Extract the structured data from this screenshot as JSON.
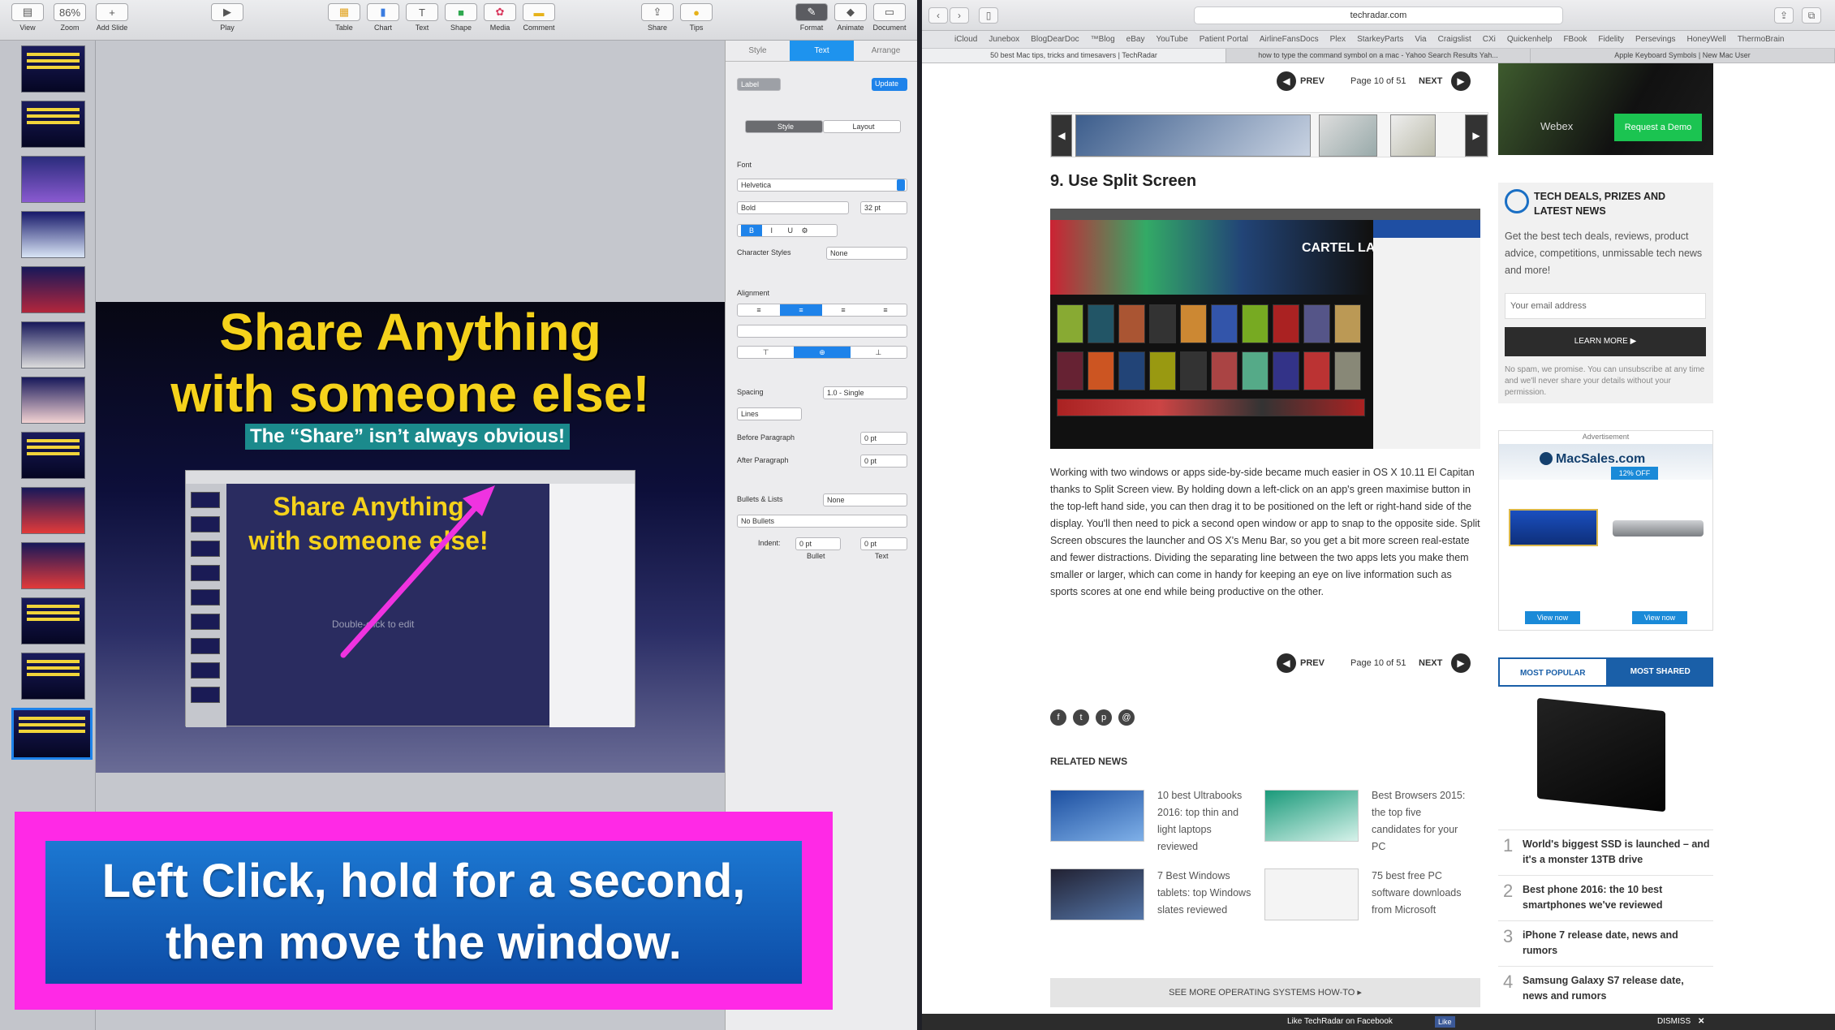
{
  "keynote": {
    "toolbar": {
      "view": "View",
      "zoom": "Zoom",
      "zoom_value": "86%",
      "add_slide": "Add Slide",
      "play": "Play",
      "table": "Table",
      "chart": "Chart",
      "text": "Text",
      "shape": "Shape",
      "media": "Media",
      "comment": "Comment",
      "share": "Share",
      "tips": "Tips",
      "format": "Format",
      "animate": "Animate",
      "document": "Document"
    },
    "slide": {
      "title_line1": "Share Anything",
      "title_line2": "with someone else!",
      "subtitle": "The “Share” isn’t always obvious!",
      "embedded_line1": "Share Anything",
      "embedded_line2": "with someone else!",
      "embedded_placeholder": "Double-click to edit"
    },
    "inspector": {
      "tabs": [
        "Style",
        "Text",
        "Arrange"
      ],
      "paragraph_style": "Label",
      "update": "Update",
      "style_tab": "Style",
      "layout_tab": "Layout",
      "font_label": "Font",
      "font": "Helvetica",
      "weight": "Bold",
      "size": "32 pt",
      "character_styles_label": "Character Styles",
      "character_styles": "None",
      "alignment_label": "Alignment",
      "spacing_label": "Spacing",
      "spacing": "1.0 - Single",
      "lines": "Lines",
      "before_paragraph": "Before Paragraph",
      "before_value": "0 pt",
      "after_paragraph": "After Paragraph",
      "after_value": "0 pt",
      "bullets_label": "Bullets & Lists",
      "bullets": "None",
      "no_bullets": "No Bullets",
      "indent_label": "Indent:",
      "indent_bullet": "0 pt",
      "indent_text": "0 pt",
      "bullet_caption": "Bullet",
      "text_caption": "Text"
    }
  },
  "callout": {
    "line1": "Left Click, hold for a second,",
    "line2": "then move the window."
  },
  "safari": {
    "url": "techradar.com",
    "bookmarks": [
      "iCloud",
      "Junebox",
      "BlogDearDoc",
      "™Blog",
      "eBay",
      "YouTube",
      "Patient Portal",
      "AirlineFansDocs",
      "Plex",
      "StarkeyParts",
      "Via",
      "Craigslist",
      "CXi",
      "Quickenhelp",
      "FBook",
      "Fidelity",
      "Persevings",
      "HoneyWell",
      "ThermoBrain"
    ],
    "tabs": [
      "50 best Mac tips, tricks and timesavers | TechRadar",
      "how to type the command symbol on a mac - Yahoo Search Results Yah...",
      "Apple Keyboard Symbols | New Mac User"
    ],
    "pager": {
      "prev": "PREV",
      "page": "Page 10 of 51",
      "next": "NEXT"
    },
    "heading": "9. Use Split Screen",
    "article": "Working with two windows or apps side-by-side became much easier in OS X 10.11 El Capitan thanks to Split Screen view. By holding down a left-click on an app's green maximise button in the top-left hand side, you can then drag it to be positioned on the left or right-hand side of the display. You'll then need to pick a second open window or app to snap to the opposite side. Split Screen obscures the launcher and OS X's Menu Bar, so you get a bit more screen real-estate and fewer distractions. Dividing the separating line between the two apps lets you make them smaller or larger, which can come in handy for keeping an eye on live information such as sports scores at one end while being productive on the other.",
    "screenshot_label": "CARTEL LAND",
    "related_heading": "RELATED NEWS",
    "related": [
      "10 best Ultrabooks 2016: top thin and light laptops reviewed",
      "Best Browsers 2015: the top five candidates for your PC",
      "7 Best Windows tablets: top Windows slates reviewed",
      "75 best free PC software downloads from Microsoft"
    ],
    "see_more": "SEE MORE OPERATING SYSTEMS HOW-TO ▸",
    "ad_top": {
      "brand": "Webex",
      "button": "Request a Demo"
    },
    "deals": {
      "title": "TECH DEALS, PRIZES AND LATEST NEWS",
      "desc": "Get the best tech deals, reviews, product advice, competitions, unmissable tech news and more!",
      "email_placeholder": "Your email address",
      "button": "LEARN MORE ▶",
      "note": "No spam, we promise. You can unsubscribe at any time and we'll never share your details without your permission."
    },
    "ad2": {
      "label": "Advertisement",
      "brand": "MacSales.com",
      "offer": "12% OFF",
      "view_now": "View now"
    },
    "popular_tabs": [
      "MOST POPULAR",
      "MOST SHARED"
    ],
    "popular": [
      "World's biggest SSD is launched – and it's a monster 13TB drive",
      "Best phone 2016: the 10 best smartphones we've reviewed",
      "iPhone 7 release date, news and rumors",
      "Samsung Galaxy S7 release date, news and rumors"
    ],
    "fb_bar": "Like TechRadar on Facebook",
    "fb_like": "Like",
    "dismiss": "DISMISS"
  },
  "colors": {
    "accent": "#1e93ee",
    "callout_border": "#ff29e6",
    "slide_title": "#f5d21b"
  }
}
